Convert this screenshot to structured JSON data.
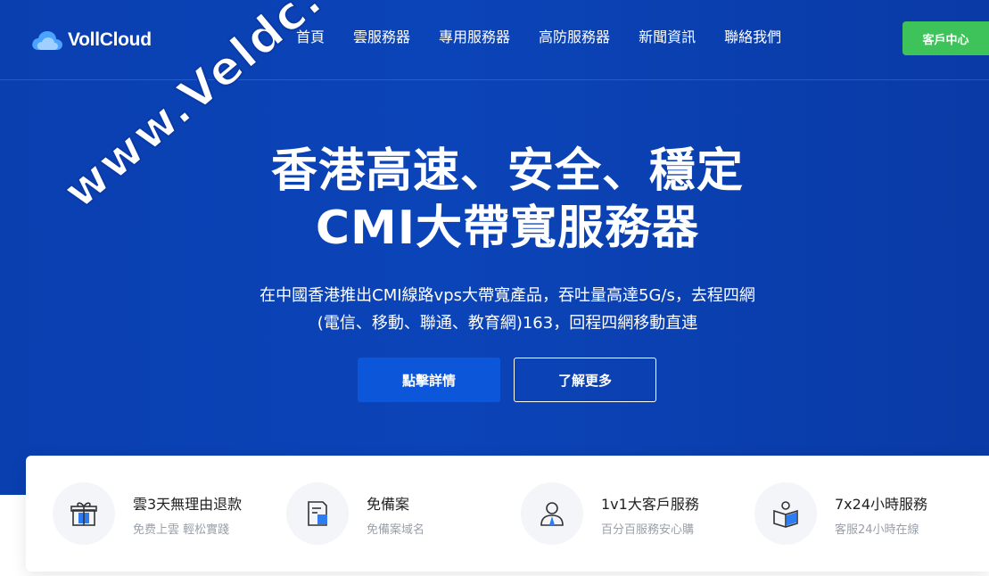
{
  "brand": {
    "logo_text": "VollCloud"
  },
  "nav": {
    "items": [
      "首頁",
      "雲服務器",
      "專用服務器",
      "高防服務器",
      "新聞資訊",
      "聯絡我們"
    ],
    "client_button": "客戶中心"
  },
  "hero": {
    "title_line1": "香港高速、安全、穩定",
    "title_line2": "CMI大帶寬服務器",
    "subtitle_line1": "在中國香港推出CMI線路vps大帶寬產品，吞吐量高達5G/s，去程四網",
    "subtitle_line2": "(電信、移動、聯通、教育網)163，回程四網移動直連",
    "primary_button": "點擊詳情",
    "secondary_button": "了解更多"
  },
  "watermark": "www.Veldc.com",
  "features": [
    {
      "icon": "gift-icon",
      "title": "雲3天無理由退款",
      "desc": "免费上雲 輕松實踐"
    },
    {
      "icon": "document-icon",
      "title": "免備案",
      "desc": "免備案域名"
    },
    {
      "icon": "support-agent-icon",
      "title": "1v1大客戶服務",
      "desc": "百分百服務安心購"
    },
    {
      "icon": "reading-icon",
      "title": "7x24小時服務",
      "desc": "客服24小時在線"
    }
  ],
  "colors": {
    "hero_bg": "#0b44b8",
    "accent_green": "#3ec35a",
    "primary_button": "#0b56d9",
    "icon_blue": "#2f7bf0"
  }
}
